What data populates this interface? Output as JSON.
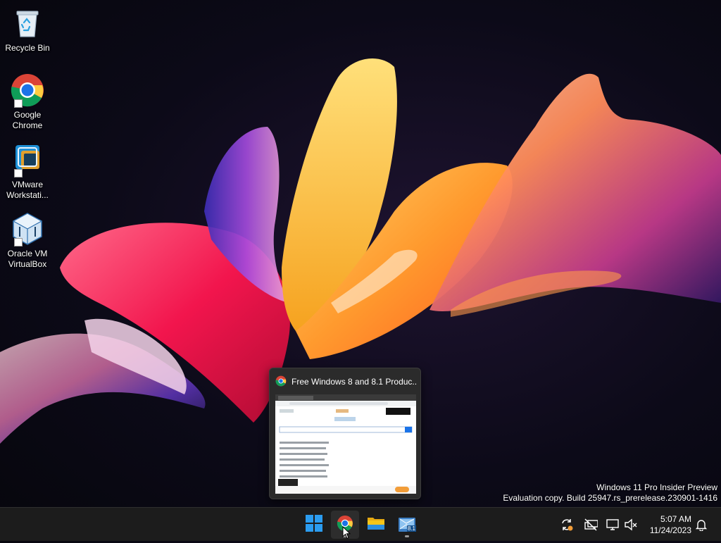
{
  "desktop": {
    "icons": [
      {
        "label": "Recycle Bin",
        "icon": "recycle-bin-icon"
      },
      {
        "label": "Google Chrome",
        "icon": "chrome-icon"
      },
      {
        "label": "VMware Workstati...",
        "icon": "vmware-icon"
      },
      {
        "label": "Oracle VM VirtualBox",
        "icon": "virtualbox-icon"
      }
    ]
  },
  "watermark": {
    "line1": "Windows 11 Pro Insider Preview",
    "line2": "Evaluation copy. Build 25947.rs_prerelease.230901-1416"
  },
  "preview": {
    "title": "Free Windows 8 and 8.1 Produc...",
    "icon": "chrome-icon"
  },
  "taskbar": {
    "buttons": [
      {
        "name": "start",
        "icon": "windows-start-icon"
      },
      {
        "name": "chrome",
        "icon": "chrome-icon",
        "active": true
      },
      {
        "name": "file-explorer",
        "icon": "folder-icon"
      },
      {
        "name": "windows-8-1-vm",
        "icon": "vm-window-icon",
        "badge": "8.1"
      }
    ],
    "tray": [
      "sync-icon",
      "network-off-icon",
      "display-icon",
      "volume-muted-icon"
    ],
    "clock": {
      "time": "5:07 AM",
      "date": "11/24/2023"
    },
    "notification_icon": "bell-icon"
  },
  "colors": {
    "taskbar_bg": "#1c1c1c",
    "start_blue": "#2b9cf0",
    "folder_yellow": "#f5c518"
  }
}
